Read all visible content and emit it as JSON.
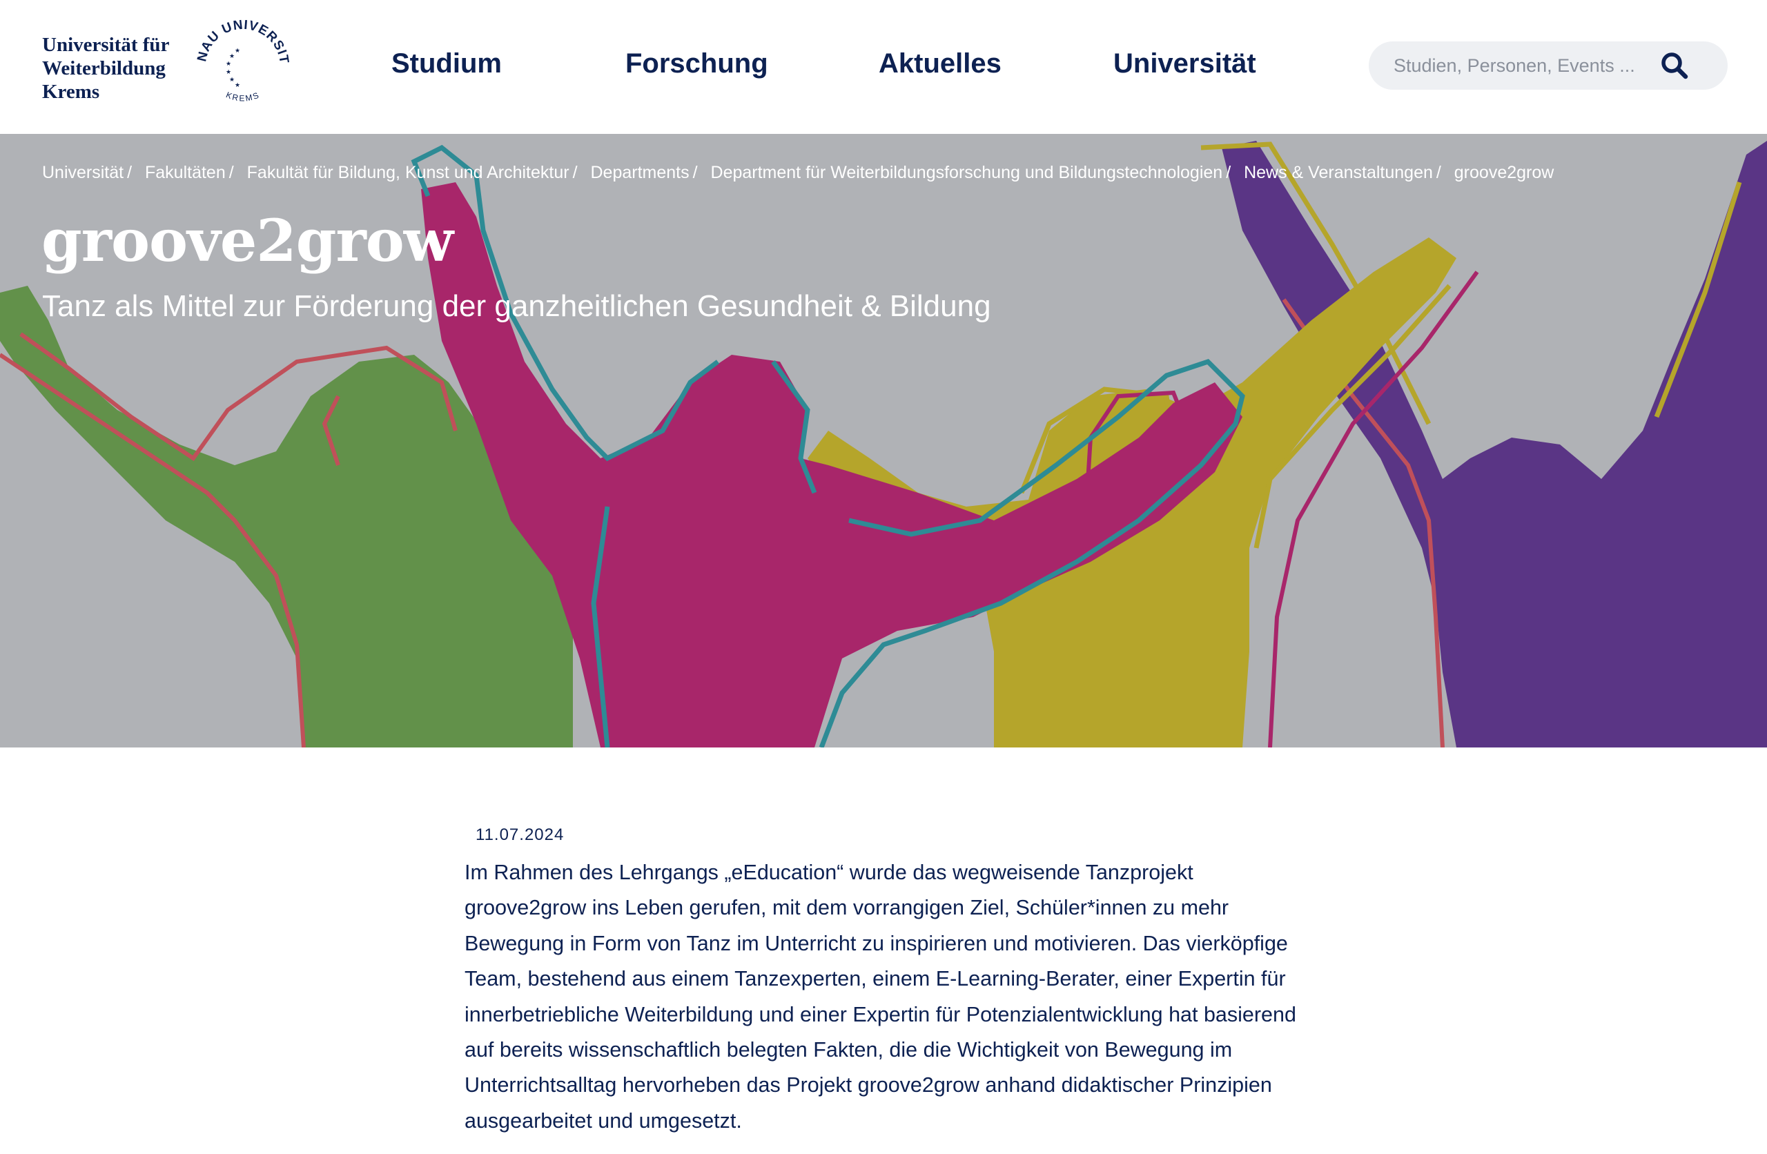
{
  "logo": {
    "lines": [
      "Universität für",
      "Weiterbildung",
      "Krems"
    ],
    "seal_top": "DONAU UNIVERSITÄT",
    "seal_bottom": "KREMS"
  },
  "nav": {
    "items": [
      "Studium",
      "Forschung",
      "Aktuelles",
      "Universität"
    ]
  },
  "search": {
    "placeholder": "Studien, Personen, Events ..."
  },
  "breadcrumb": [
    "Universität",
    "Fakultäten",
    "Fakultät für Bildung, Kunst und Architektur",
    "Departments",
    "Department für Weiterbildungsforschung und Bildungstechnologien",
    "News & Veranstaltungen",
    "groove2grow"
  ],
  "hero": {
    "title": "groove2grow",
    "subtitle": "Tanz als Mittel zur Förderung der ganzheitlichen Gesundheit & Bildung"
  },
  "article": {
    "date": "11.07.2024",
    "body": "Im Rahmen des Lehrgangs „eEducation“ wurde das wegweisende Tanzprojekt groove2grow ins Leben gerufen, mit dem vorrangigen Ziel, Schüler*innen zu mehr Bewegung in Form von Tanz im Unterricht zu inspirieren und motivieren. Das vierköpfige Team, bestehend aus einem Tanzexperten, einem E-Learning-Berater, einer Expertin für innerbetriebliche Weiterbildung und einer Expertin für Potenzialentwicklung hat basierend auf bereits wissenschaftlich belegten Fakten, die die Wichtigkeit von Bewegung im Unterrichtsalltag hervorheben das Projekt groove2grow anhand didaktischer Prinzipien ausgearbeitet und umgesetzt."
  },
  "colors": {
    "navy": "#0d2152",
    "hero_bg": "#b0b2b6",
    "green": "#62914a",
    "magenta": "#a8266a",
    "yellow": "#b5a52b",
    "purple": "#5a3585",
    "teal": "#2e8b95",
    "red_outline": "#c0505a"
  }
}
